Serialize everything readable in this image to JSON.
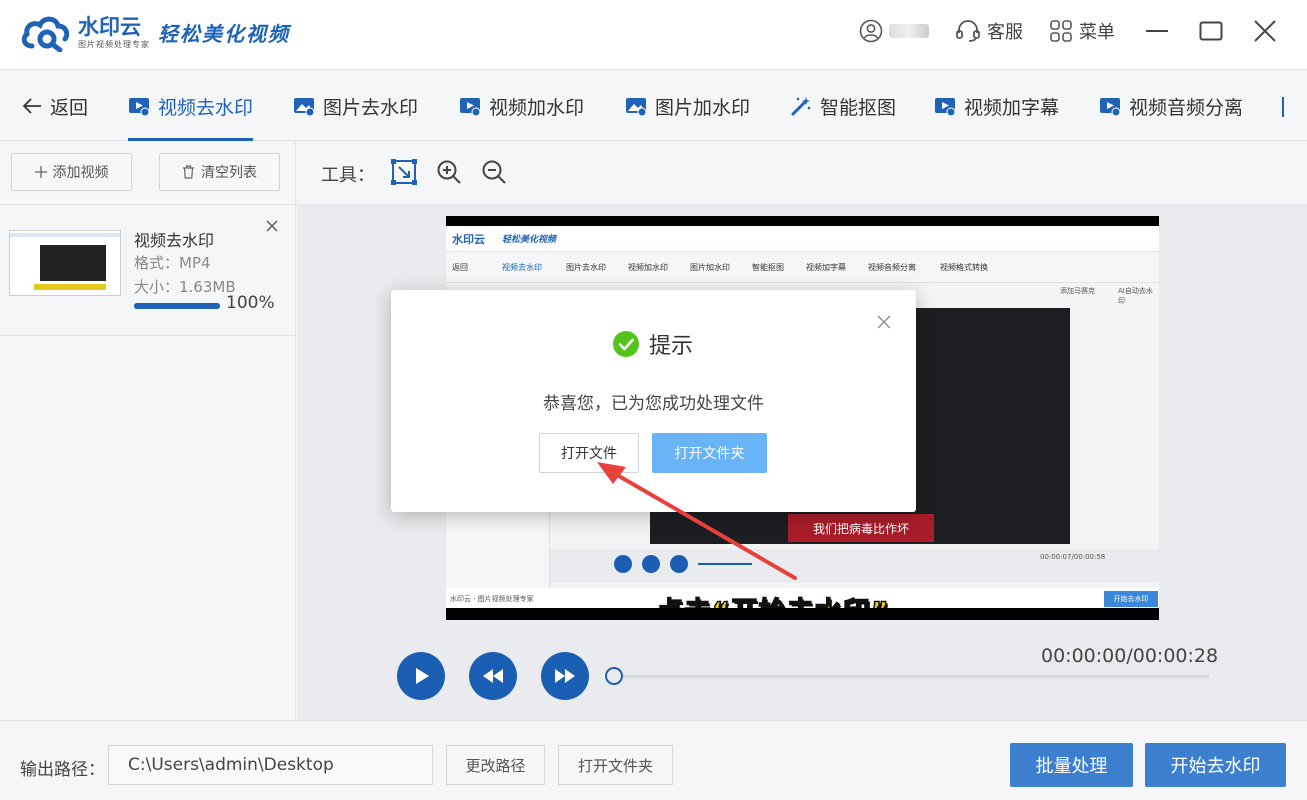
{
  "app": {
    "name": "水印云",
    "subtitle": "图片视频处理专家",
    "slogan": "轻松美化视频"
  },
  "titlebar": {
    "service_label": "客服",
    "menu_label": "菜单"
  },
  "nav": {
    "back_label": "返回",
    "items": [
      {
        "label": "视频去水印"
      },
      {
        "label": "图片去水印"
      },
      {
        "label": "视频加水印"
      },
      {
        "label": "图片加水印"
      },
      {
        "label": "智能抠图"
      },
      {
        "label": "视频加字幕"
      },
      {
        "label": "视频音频分离"
      }
    ]
  },
  "left_panel": {
    "add_video_label": "添加视频",
    "clear_list_label": "清空列表",
    "file": {
      "name": "视频去水印",
      "format": "格式：MP4",
      "size": "大小：1.63MB",
      "progress_percent": 100,
      "progress_label": "100%"
    }
  },
  "tools": {
    "label": "工具："
  },
  "preview": {
    "inner_title": "水印云",
    "inner_slogan": "轻松美化视频",
    "inner_nav": [
      "返回",
      "视频去水印",
      "图片去水印",
      "视频加水印",
      "图片加水印",
      "智能抠图",
      "视频加字幕",
      "视频音频分离",
      "视频格式转换"
    ],
    "inner_tool_right1": "添加马赛克",
    "inner_tool_right2": "AI自动去水印",
    "red_subtitle": "我们把病毒比作坏",
    "inner_time": "00:00:07/00:00:58",
    "inner_footer": "水印云 · 图片视频处理专家",
    "caption": "点击“开始去水印”",
    "inner_start_label": "开始去水印"
  },
  "player": {
    "time": "00:00:00/00:00:28",
    "progress_fraction": 0
  },
  "bottom": {
    "output_label": "输出路径：",
    "output_path": "C:\\Users\\admin\\Desktop",
    "change_path_label": "更改路径",
    "open_folder_label": "打开文件夹",
    "batch_label": "批量处理",
    "start_label": "开始去水印"
  },
  "dialog": {
    "title": "提示",
    "message": "恭喜您，已为您成功处理文件",
    "open_file_label": "打开文件",
    "open_folder_label": "打开文件夹"
  },
  "colors": {
    "brand": "#1e63b8",
    "primary_button": "#3d7fcf",
    "dialog_primary": "#69b3f7",
    "success": "#52c41a",
    "annotation_arrow": "#e8403a"
  }
}
